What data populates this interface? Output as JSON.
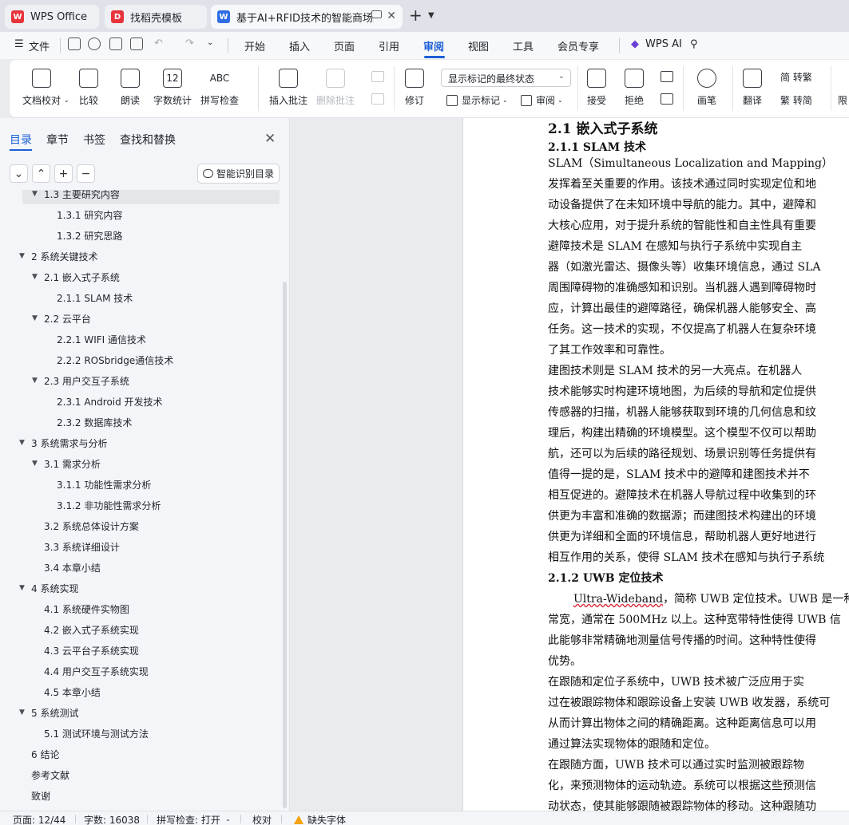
{
  "tabs": [
    {
      "label": "WPS Office",
      "logo": "W"
    },
    {
      "label": "找稻壳模板",
      "logo": "D"
    },
    {
      "label": "基于AI+RFID技术的智能商场购",
      "logo": "W"
    }
  ],
  "menu": {
    "file": "文件",
    "items": [
      "开始",
      "插入",
      "页面",
      "引用",
      "审阅",
      "视图",
      "工具",
      "会员专享"
    ],
    "active": "审阅",
    "wps_ai": "WPS AI"
  },
  "ribbon": {
    "doc_check": "文档校对",
    "compare": "比较",
    "read_aloud": "朗读",
    "word_count": "字数统计",
    "spell_check": "拼写检查",
    "spell_icon_text": "ABC",
    "word_count_icon_text": "12",
    "insert_comment": "插入批注",
    "delete_comment": "删除批注",
    "revise": "修订",
    "markup_select": "显示标记的最终状态",
    "show_markup": "显示标记",
    "review": "审阅",
    "accept": "接受",
    "reject": "拒绝",
    "pen": "画笔",
    "translate": "翻译",
    "to_traditional": "简 转繁",
    "to_simplified": "繁 转简",
    "more": "限"
  },
  "sidebar": {
    "tabs": [
      "目录",
      "章节",
      "书签",
      "查找和替换"
    ],
    "active_tab": "目录",
    "smart_toc": "智能识别目录",
    "toc": [
      {
        "label": "1.3 主要研究内容",
        "level": 2,
        "arrow": "▼",
        "selected": true
      },
      {
        "label": "1.3.1 研究内容",
        "level": 3,
        "arrow": ""
      },
      {
        "label": "1.3.2 研究思路",
        "level": 3,
        "arrow": ""
      },
      {
        "label": "2  系统关键技术",
        "level": 1,
        "arrow": "▼"
      },
      {
        "label": "2.1 嵌入式子系统",
        "level": 2,
        "arrow": "▼"
      },
      {
        "label": "2.1.1 SLAM 技术",
        "level": 3,
        "arrow": ""
      },
      {
        "label": "2.2 云平台",
        "level": 2,
        "arrow": "▼"
      },
      {
        "label": "2.2.1 WIFI 通信技术",
        "level": 3,
        "arrow": ""
      },
      {
        "label": "2.2.2 ROSbridge通信技术",
        "level": 3,
        "arrow": ""
      },
      {
        "label": "2.3 用户交互子系统",
        "level": 2,
        "arrow": "▼"
      },
      {
        "label": "2.3.1 Android 开发技术",
        "level": 3,
        "arrow": ""
      },
      {
        "label": "2.3.2  数据库技术",
        "level": 3,
        "arrow": ""
      },
      {
        "label": "3 系统需求与分析",
        "level": 1,
        "arrow": "▼"
      },
      {
        "label": "3.1 需求分析",
        "level": 2,
        "arrow": "▼"
      },
      {
        "label": "3.1.1  功能性需求分析",
        "level": 3,
        "arrow": ""
      },
      {
        "label": "3.1.2  非功能性需求分析",
        "level": 3,
        "arrow": ""
      },
      {
        "label": "3.2 系统总体设计方案",
        "level": 2,
        "arrow": ""
      },
      {
        "label": "3.3 系统详细设计",
        "level": 2,
        "arrow": ""
      },
      {
        "label": "3.4 本章小结",
        "level": 2,
        "arrow": ""
      },
      {
        "label": "4  系统实现",
        "level": 1,
        "arrow": "▼"
      },
      {
        "label": "4.1 系统硬件实物图",
        "level": 2,
        "arrow": ""
      },
      {
        "label": "4.2 嵌入式子系统实现",
        "level": 2,
        "arrow": ""
      },
      {
        "label": "4.3 云平台子系统实现",
        "level": 2,
        "arrow": ""
      },
      {
        "label": "4.4  用户交互子系统实现",
        "level": 2,
        "arrow": ""
      },
      {
        "label": "4.5  本章小结",
        "level": 2,
        "arrow": ""
      },
      {
        "label": "5  系统测试",
        "level": 1,
        "arrow": "▼"
      },
      {
        "label": "5.1  测试环境与测试方法",
        "level": 2,
        "arrow": ""
      },
      {
        "label": "6  结论",
        "level": 1,
        "arrow": ""
      },
      {
        "label": "参考文献",
        "level": 1,
        "arrow": ""
      },
      {
        "label": "致谢",
        "level": 1,
        "arrow": ""
      }
    ]
  },
  "document": {
    "lines": [
      {
        "text": "2.1 嵌入式子系统",
        "style": "h2"
      },
      {
        "text": "2.1.1 SLAM 技术",
        "style": "h3"
      },
      {
        "text": "    SLAM（Simultaneous Localization and Mapping）",
        "style": "p"
      },
      {
        "text": "发挥着至关重要的作用。该技术通过同时实现定位和地",
        "style": "p"
      },
      {
        "text": "动设备提供了在未知环境中导航的能力。其中，避障和",
        "style": "p"
      },
      {
        "text": "大核心应用，对于提升系统的智能性和自主性具有重要",
        "style": "p"
      },
      {
        "text": "    避障技术是 SLAM 在感知与执行子系统中实现自主",
        "style": "p"
      },
      {
        "text": "器（如激光雷达、摄像头等）收集环境信息，通过 SLA",
        "style": "p"
      },
      {
        "text": "周围障碍物的准确感知和识别。当机器人遇到障碍物时",
        "style": "p"
      },
      {
        "text": "应，计算出最佳的避障路径，确保机器人能够安全、高",
        "style": "p"
      },
      {
        "text": "任务。这一技术的实现，不仅提高了机器人在复杂环境",
        "style": "p"
      },
      {
        "text": "了其工作效率和可靠性。",
        "style": "p"
      },
      {
        "text": "    建图技术则是 SLAM 技术的另一大亮点。在机器人",
        "style": "p"
      },
      {
        "text": "技术能够实时构建环境地图，为后续的导航和定位提供",
        "style": "p"
      },
      {
        "text": "传感器的扫描，机器人能够获取到环境的几何信息和纹",
        "style": "p"
      },
      {
        "text": "理后，构建出精确的环境模型。这个模型不仅可以帮助",
        "style": "p"
      },
      {
        "text": "航，还可以为后续的路径规划、场景识别等任务提供有",
        "style": "p"
      },
      {
        "text": "    值得一提的是，SLAM 技术中的避障和建图技术并不",
        "style": "p"
      },
      {
        "text": "相互促进的。避障技术在机器人导航过程中收集到的环",
        "style": "p"
      },
      {
        "text": "供更为丰富和准确的数据源；而建图技术构建出的环境",
        "style": "p"
      },
      {
        "text": "供更为详细和全面的环境信息，帮助机器人更好地进行",
        "style": "p"
      },
      {
        "text": "相互作用的关系，使得 SLAM 技术在感知与执行子系统",
        "style": "p"
      },
      {
        "text": "2.1.2   UWB 定位技术",
        "style": "h3"
      },
      {
        "text": "Ultra-Wideband，简称 UWB 定位技术。UWB 是一种",
        "style": "p-uwb"
      },
      {
        "text": "常宽，通常在 500MHz 以上。这种宽带特性使得 UWB 信",
        "style": "p"
      },
      {
        "text": "此能够非常精确地测量信号传播的时间。这种特性使得",
        "style": "p"
      },
      {
        "text": "优势。",
        "style": "p"
      },
      {
        "text": "   在跟随和定位子系统中，UWB 技术被广泛应用于实",
        "style": "p"
      },
      {
        "text": "过在被跟踪物体和跟踪设备上安装 UWB 收发器，系统可",
        "style": "p"
      },
      {
        "text": "从而计算出物体之间的精确距离。这种距离信息可以用",
        "style": "p"
      },
      {
        "text": "通过算法实现物体的跟随和定位。",
        "style": "p"
      },
      {
        "text": "    在跟随方面，UWB 技术可以通过实时监测被跟踪物",
        "style": "p"
      },
      {
        "text": "化，来预测物体的运动轨迹。系统可以根据这些预测信",
        "style": "p"
      },
      {
        "text": "动状态，使其能够跟随被跟踪物体的移动。这种跟随功",
        "style": "p"
      }
    ]
  },
  "status": {
    "page": "页面: 12/44",
    "words": "字数: 16038",
    "spell": "拼写检查: 打开",
    "proof": "校对",
    "missing_font": "缺失字体"
  },
  "colors": {
    "accent": "#1d5fd6",
    "wps_red": "#e8333b",
    "warn": "#f2a20c"
  }
}
